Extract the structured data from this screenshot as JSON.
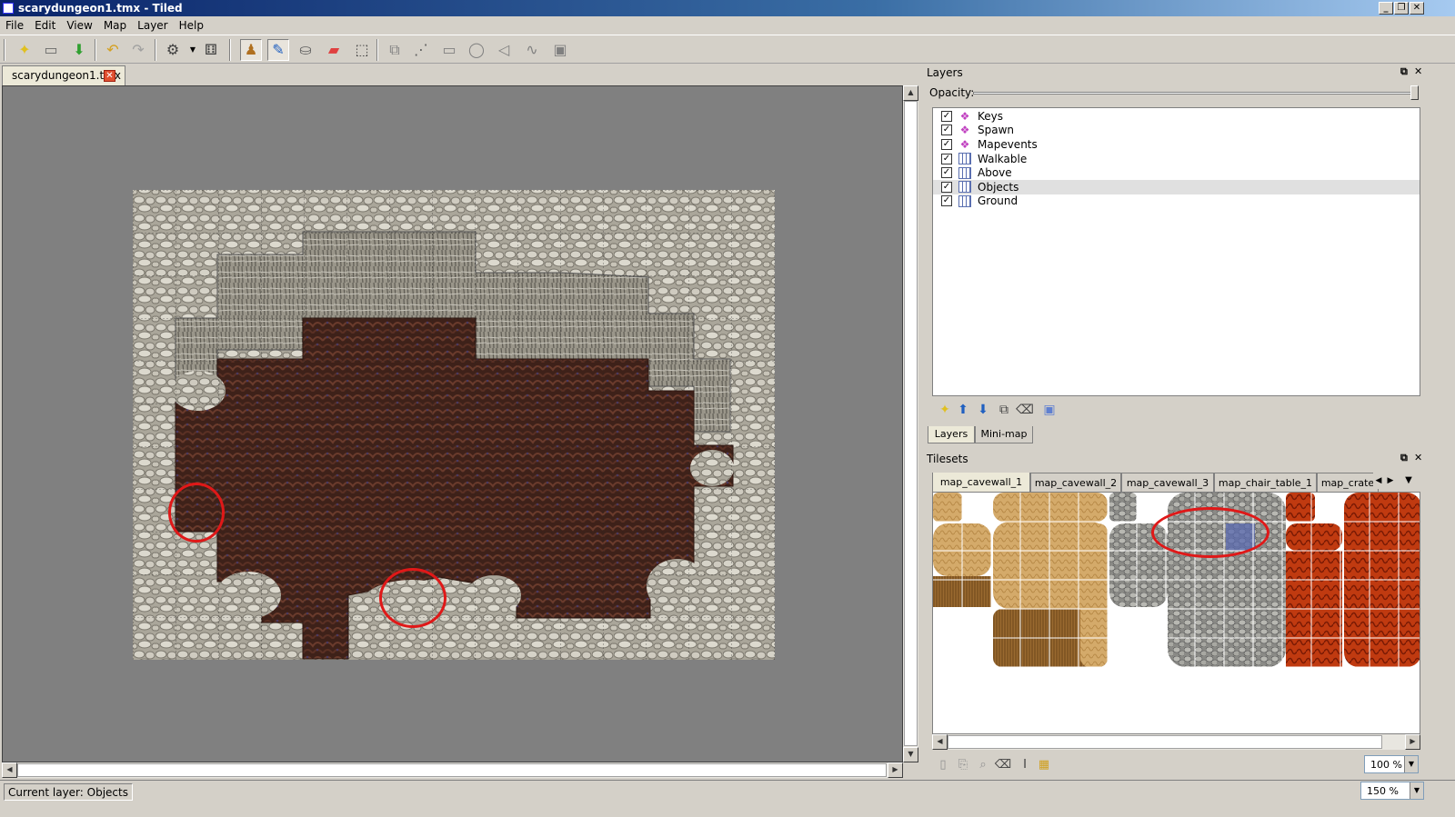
{
  "window": {
    "title": "scarydungeon1.tmx - Tiled"
  },
  "menu": [
    "File",
    "Edit",
    "View",
    "Map",
    "Layer",
    "Help"
  ],
  "toolbar": {
    "icons": [
      "new-map-icon",
      "open-file-icon",
      "save-icon",
      "undo-icon",
      "redo-icon",
      "command-icon",
      "random-dice-icon",
      "stamp-brush-icon",
      "terrain-brush-icon",
      "bucket-fill-icon",
      "eraser-icon",
      "rectangle-select-icon",
      "select-objects-icon",
      "edit-polygons-icon",
      "insert-rectangle-icon",
      "insert-ellipse-icon",
      "insert-polygon-icon",
      "insert-polyline-icon",
      "insert-tile-icon"
    ]
  },
  "document_tab": {
    "label": "scarydungeon1.tmx"
  },
  "layers_panel": {
    "title": "Layers",
    "opacity_label": "Opacity:",
    "layers": [
      {
        "name": "Keys",
        "type": "object",
        "visible": true,
        "selected": false
      },
      {
        "name": "Spawn",
        "type": "object",
        "visible": true,
        "selected": false
      },
      {
        "name": "Mapevents",
        "type": "object",
        "visible": true,
        "selected": false
      },
      {
        "name": "Walkable",
        "type": "tile",
        "visible": true,
        "selected": false
      },
      {
        "name": "Above",
        "type": "tile",
        "visible": true,
        "selected": false
      },
      {
        "name": "Objects",
        "type": "tile",
        "visible": true,
        "selected": true
      },
      {
        "name": "Ground",
        "type": "tile",
        "visible": true,
        "selected": false
      }
    ],
    "tabs": [
      "Layers",
      "Mini-map"
    ]
  },
  "tilesets_panel": {
    "title": "Tilesets",
    "tabs": [
      "map_cavewall_1",
      "map_cavewall_2",
      "map_cavewall_3",
      "map_chair_table_1",
      "map_crate"
    ],
    "zoom": "100 %"
  },
  "status": {
    "current_layer": "Current layer: Objects",
    "zoom": "150 %"
  },
  "colors": {
    "highlight_circle": "#e01818",
    "floor": "#4a2a22",
    "stone": "#b8b4a8"
  }
}
